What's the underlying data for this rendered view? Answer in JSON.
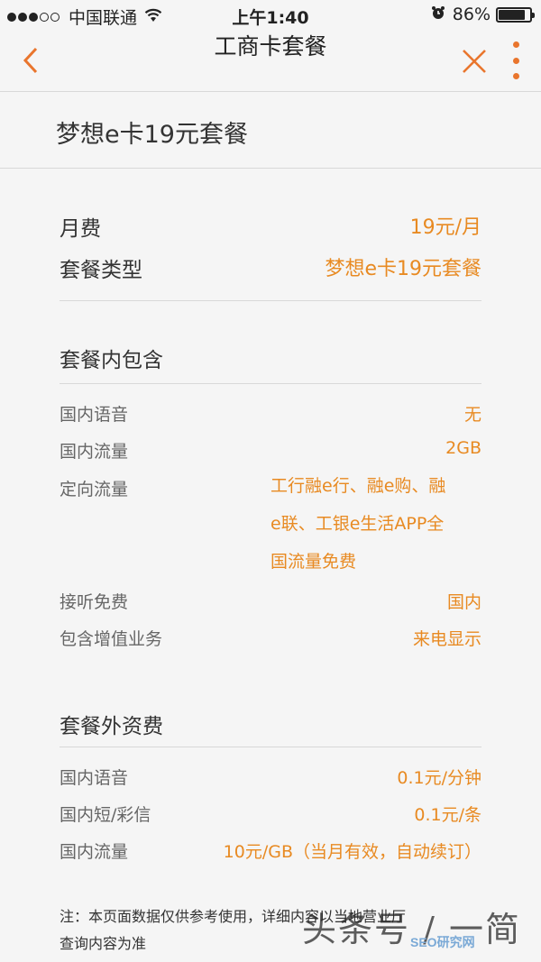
{
  "status_bar": {
    "carrier": "中国联通",
    "time": "上午1:40",
    "battery_percent": "86%",
    "battery_level": 0.86
  },
  "nav": {
    "title": "工商卡套餐"
  },
  "plan": {
    "name": "梦想e卡19元套餐"
  },
  "summary": {
    "monthly_fee_label": "月费",
    "monthly_fee_value": "19元/月",
    "plan_type_label": "套餐类型",
    "plan_type_value": "梦想e卡19元套餐"
  },
  "included": {
    "title": "套餐内包含",
    "items": [
      {
        "label": "国内语音",
        "value": "无"
      },
      {
        "label": "国内流量",
        "value": "2GB"
      },
      {
        "label": "定向流量",
        "value_lines": [
          "工行融e行、融e购、融",
          "e联、工银e生活APP全",
          "国流量免费"
        ]
      },
      {
        "label": "接听免费",
        "value": "国内"
      },
      {
        "label": "包含增值业务",
        "value": "来电显示"
      }
    ]
  },
  "extra": {
    "title": "套餐外资费",
    "items": [
      {
        "label": "国内语音",
        "value": "0.1元/分钟"
      },
      {
        "label": "国内短/彩信",
        "value": "0.1元/条"
      },
      {
        "label": "国内流量",
        "value": "10元/GB（当月有效，自动续订）"
      }
    ]
  },
  "note": {
    "line1": "注：本页面数据仅供参考使用，详细内容以当地营业厅",
    "line2": "查询内容为准"
  },
  "watermark": {
    "text": "头条号 / 一简",
    "badge": "SEO研究网"
  },
  "colors": {
    "accent": "#e88a22",
    "nav_icon": "#e9752d",
    "background": "#f5f5f5"
  }
}
